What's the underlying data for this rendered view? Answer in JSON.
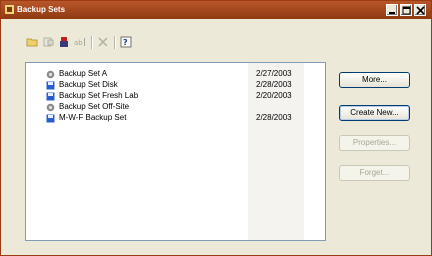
{
  "window": {
    "title": "Backup Sets",
    "controls": {
      "minimize": "minimize-icon",
      "maximize": "maximize-icon",
      "close": "close-icon"
    }
  },
  "toolbar": {
    "items": [
      "new-folder-icon",
      "properties-icon",
      "delete-icon",
      "rename-icon",
      "remove-icon",
      "help-icon"
    ]
  },
  "list": {
    "rows": [
      {
        "name": "Backup Set A",
        "date": "2/27/2003",
        "icon": "network-backup-icon"
      },
      {
        "name": "Backup Set Disk",
        "date": "2/28/2003",
        "icon": "disk-backup-icon"
      },
      {
        "name": "Backup Set Fresh Lab",
        "date": "2/20/2003",
        "icon": "disk-backup-icon"
      },
      {
        "name": "Backup Set Off-Site",
        "date": "",
        "icon": "network-backup-icon"
      },
      {
        "name": "M-W-F Backup Set",
        "date": "2/28/2003",
        "icon": "disk-backup-icon"
      }
    ]
  },
  "buttons": {
    "more": "More...",
    "create_new": "Create New...",
    "properties": "Properties...",
    "forget": "Forget..."
  },
  "colors": {
    "titlebar": "#a2461c",
    "face": "#ece9d8",
    "list_border": "#7f9db9"
  }
}
